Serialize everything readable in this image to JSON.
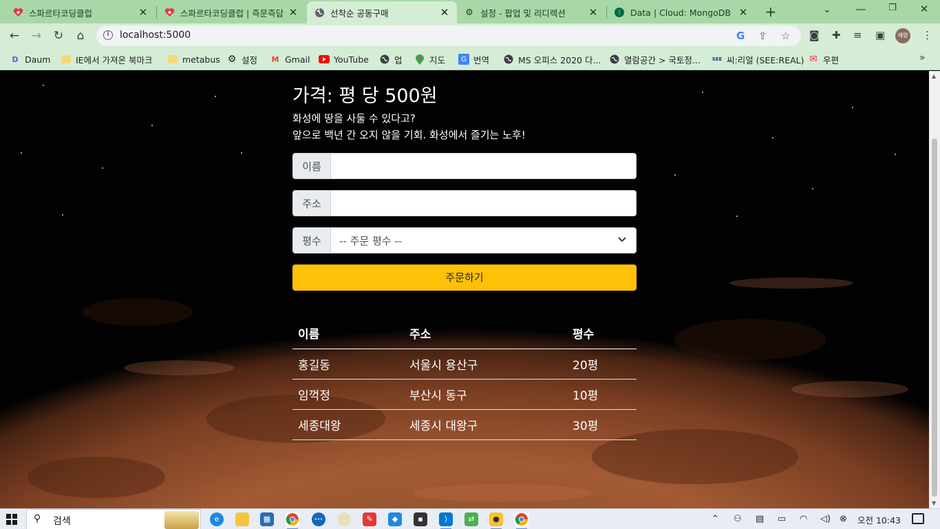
{
  "browser": {
    "tabs": [
      {
        "title": "스파르타코딩클럽",
        "icon": "heart-icon",
        "active": false
      },
      {
        "title": "스파르타코딩클럽 | 즉문즉답",
        "icon": "heart-icon",
        "active": false
      },
      {
        "title": "선착순 공동구매",
        "icon": "globe-icon",
        "active": true
      },
      {
        "title": "설정 - 팝업 및 리디렉션",
        "icon": "gear-icon",
        "active": false
      },
      {
        "title": "Data | Cloud: MongoDB Cloud",
        "icon": "leaf-icon",
        "active": false
      }
    ],
    "url": "localhost:5000",
    "profile_label": "재영",
    "bookmarks": [
      {
        "label": "Daum",
        "icon": "daum-icon"
      },
      {
        "label": "IE에서 가져온 북마크",
        "icon": "folder-icon"
      },
      {
        "label": "metabus",
        "icon": "folder-icon"
      },
      {
        "label": "설정",
        "icon": "gear-icon"
      },
      {
        "label": "Gmail",
        "icon": "gmail-icon"
      },
      {
        "label": "YouTube",
        "icon": "youtube-icon"
      },
      {
        "label": "업",
        "icon": "globe-icon"
      },
      {
        "label": "지도",
        "icon": "maps-icon"
      },
      {
        "label": "번역",
        "icon": "translate-icon"
      },
      {
        "label": "MS 오피스 2020 다...",
        "icon": "globe-icon"
      },
      {
        "label": "열람공간 > 국토정...",
        "icon": "globe-icon"
      },
      {
        "label": "씨:리얼 (SEE:REAL)",
        "icon": "seereal-icon"
      },
      {
        "label": "우편",
        "icon": "post-icon"
      }
    ]
  },
  "page": {
    "price": "가격: 평 당 500원",
    "desc_line1": "화성에 땅을 사둘 수 있다고?",
    "desc_line2": "앞으로 백년 간 오지 않을 기회. 화성에서 즐기는 노후!",
    "form": {
      "name_label": "이름",
      "name_value": "",
      "address_label": "주소",
      "address_value": "",
      "size_label": "평수",
      "size_selected": "-- 주문 평수 --",
      "submit_label": "주문하기"
    },
    "table": {
      "headers": [
        "이름",
        "주소",
        "평수"
      ],
      "rows": [
        [
          "홍길동",
          "서울시 용산구",
          "20평"
        ],
        [
          "임꺽정",
          "부산시 동구",
          "10평"
        ],
        [
          "세종대왕",
          "세종시 대왕구",
          "30평"
        ]
      ]
    }
  },
  "taskbar": {
    "search_placeholder": "검색",
    "clock": "오전 10:43"
  },
  "colors": {
    "browser_frame": "#a8d8a8",
    "toolbar": "#d4edd4",
    "order_button": "#ffc107"
  }
}
